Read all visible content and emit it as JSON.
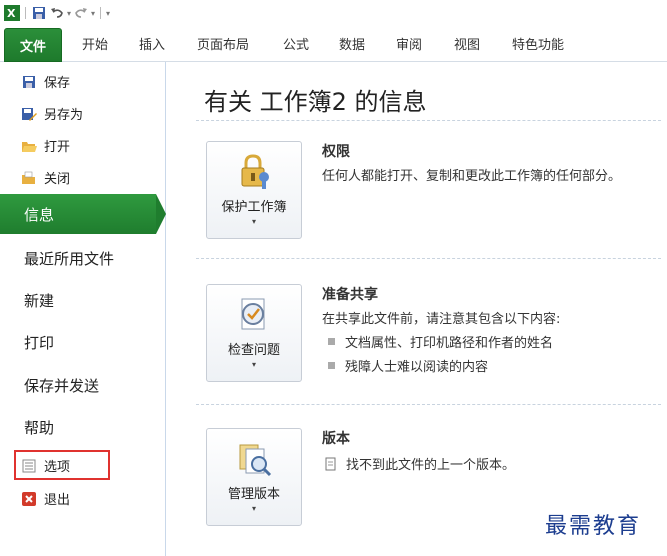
{
  "quick_access": {
    "icons": [
      "excel-icon",
      "save-icon",
      "undo-icon",
      "redo-icon",
      "customize-icon"
    ]
  },
  "ribbon": {
    "file_tab": "文件",
    "tabs": [
      "开始",
      "插入",
      "页面布局",
      "公式",
      "数据",
      "审阅",
      "视图",
      "特色功能"
    ]
  },
  "backstage": {
    "small_items": [
      {
        "label": "保存",
        "icon": "save-icon"
      },
      {
        "label": "另存为",
        "icon": "save-as-icon"
      },
      {
        "label": "打开",
        "icon": "open-folder-icon"
      },
      {
        "label": "关闭",
        "icon": "close-folder-icon"
      }
    ],
    "selected": "信息",
    "big_items": [
      "最近所用文件",
      "新建",
      "打印",
      "保存并发送",
      "帮助"
    ],
    "options_label": "选项",
    "exit_label": "退出"
  },
  "info": {
    "title": "有关 工作簿2 的信息",
    "permissions": {
      "button": "保护工作簿",
      "heading": "权限",
      "desc": "任何人都能打开、复制和更改此工作簿的任何部分。"
    },
    "prepare": {
      "button": "检查问题",
      "heading": "准备共享",
      "desc": "在共享此文件前，请注意其包含以下内容:",
      "bullets": [
        "文档属性、打印机路径和作者的姓名",
        "残障人士难以阅读的内容"
      ]
    },
    "versions": {
      "button": "管理版本",
      "heading": "版本",
      "desc": "找不到此文件的上一个版本。"
    }
  },
  "watermark": "最需教育",
  "colors": {
    "file_tab": "#2b8f3a",
    "selected": "#1f7d2e",
    "highlight_box": "#e0322f"
  }
}
